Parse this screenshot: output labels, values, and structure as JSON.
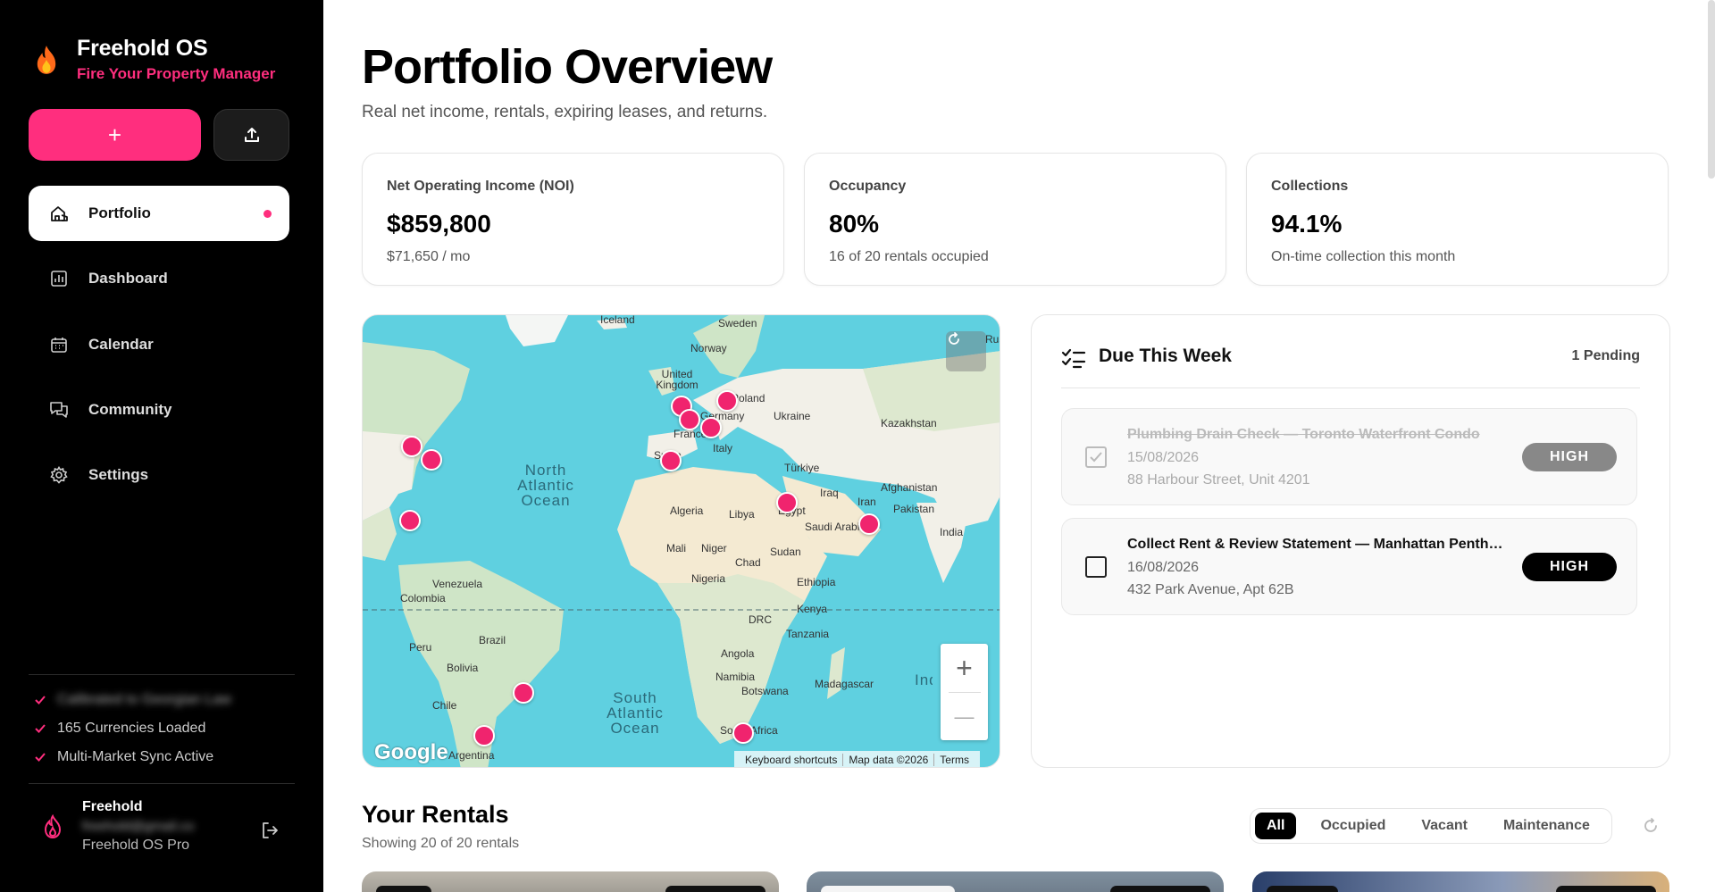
{
  "brand": {
    "name": "Freehold OS",
    "tagline": "Fire Your Property Manager"
  },
  "sidebar": {
    "add_label": "+",
    "nav": [
      {
        "label": "Portfolio",
        "icon": "house-hand-icon",
        "active": true
      },
      {
        "label": "Dashboard",
        "icon": "bar-chart-icon"
      },
      {
        "label": "Calendar",
        "icon": "calendar-icon"
      },
      {
        "label": "Community",
        "icon": "chat-icon"
      },
      {
        "label": "Settings",
        "icon": "gear-icon"
      }
    ],
    "status": [
      {
        "label": "Calibrated to Georgian Law"
      },
      {
        "label": "165 Currencies Loaded"
      },
      {
        "label": "Multi-Market Sync Active"
      }
    ],
    "user": {
      "name": "Freehold",
      "email": "freehold@gmail.co",
      "plan": "Freehold OS Pro"
    }
  },
  "header": {
    "title": "Portfolio Overview",
    "subtitle": "Real net income, rentals, expiring leases, and returns."
  },
  "kpis": [
    {
      "label": "Net Operating Income (NOI)",
      "value": "$859,800",
      "sub": "$71,650 / mo"
    },
    {
      "label": "Occupancy",
      "value": "80%",
      "sub": "16 of 20 rentals occupied"
    },
    {
      "label": "Collections",
      "value": "94.1%",
      "sub": "On-time collection this month"
    }
  ],
  "map": {
    "labels": [
      "Iceland",
      "Sweden",
      "Norway",
      "United Kingdom",
      "Poland",
      "Germany",
      "France",
      "Italy",
      "Ukraine",
      "Kazakhstan",
      "Türkiye",
      "Iraq",
      "Iran",
      "Afghanistan",
      "Pakistan",
      "India",
      "Algeria",
      "Libya",
      "Egypt",
      "Saudi Arabia",
      "Mali",
      "Niger",
      "Chad",
      "Sudan",
      "Nigeria",
      "Ethiopia",
      "Kenya",
      "DRC",
      "Tanzania",
      "Angola",
      "Namibia",
      "Botswana",
      "Madagascar",
      "South Africa",
      "Venezuela",
      "Colombia",
      "Peru",
      "Brazil",
      "Bolivia",
      "Chile",
      "Argentina",
      "Spain",
      "Rus"
    ],
    "oceans": [
      "North Atlantic Ocean",
      "South Atlantic Ocean",
      "Indian Ocean"
    ],
    "logo": "Google",
    "attribution": [
      "Keyboard shortcuts",
      "Map data ©2026",
      "Terms"
    ],
    "zoom_in": "+",
    "zoom_out": "—"
  },
  "due": {
    "title": "Due This Week",
    "pending": "1 Pending",
    "tasks": [
      {
        "title": "Plumbing Drain Check — Toronto Waterfront Condo",
        "date": "15/08/2026",
        "address": "88 Harbour Street, Unit 4201",
        "priority": "HIGH",
        "done": true
      },
      {
        "title": "Collect Rent & Review Statement — Manhattan Penthouse",
        "date": "16/08/2026",
        "address": "432 Park Avenue, Apt 62B",
        "priority": "HIGH",
        "done": false
      }
    ]
  },
  "rentals": {
    "title": "Your Rentals",
    "subtitle": "Showing 20 of 20 rentals",
    "filters": [
      "All",
      "Occupied",
      "Vacant",
      "Maintenance"
    ],
    "active_filter": "All"
  },
  "colors": {
    "accent": "#ff2e7e",
    "pin": "#f0246e",
    "ocean": "#5fd0e0",
    "land": "#f2f0e8"
  }
}
